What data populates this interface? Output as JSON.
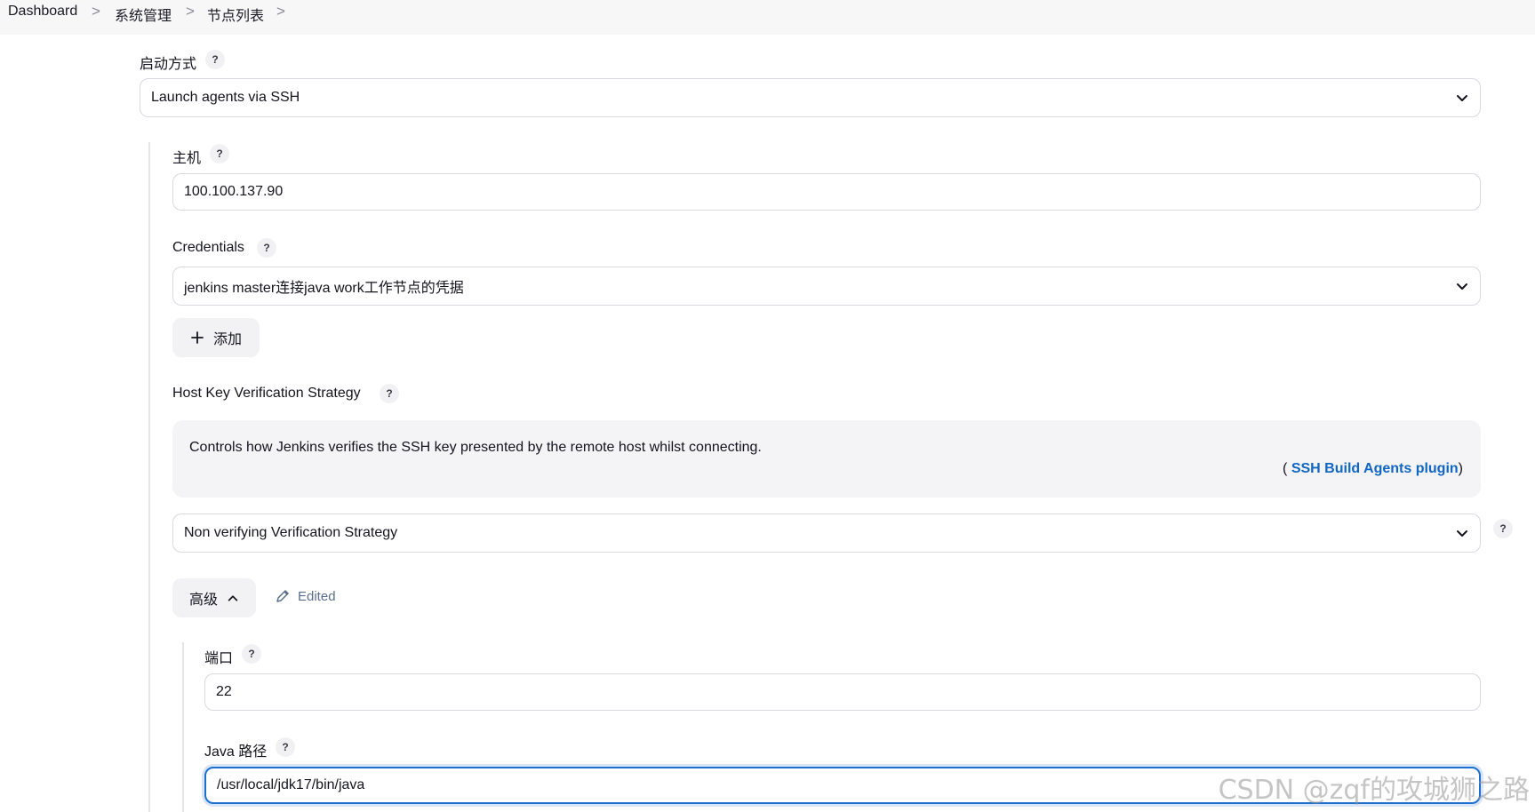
{
  "breadcrumb": {
    "items": [
      "Dashboard",
      "系统管理",
      "节点列表"
    ],
    "separator": ">"
  },
  "launch_method": {
    "label": "启动方式",
    "help": "?",
    "value": "Launch agents via SSH"
  },
  "host": {
    "label": "主机",
    "help": "?",
    "value": "100.100.137.90"
  },
  "credentials": {
    "label": "Credentials",
    "help": "?",
    "value": "jenkins master连接java work工作节点的凭据",
    "add_button": "添加"
  },
  "host_key": {
    "label": "Host Key Verification Strategy",
    "help": "?",
    "description": "Controls how Jenkins verifies the SSH key presented by the remote host whilst connecting.",
    "plugin_open": "(",
    "plugin_link": "SSH Build Agents plugin",
    "plugin_close": ")",
    "value": "Non verifying Verification Strategy",
    "side_help": "?"
  },
  "advanced": {
    "button": "高级",
    "edited": "Edited"
  },
  "port": {
    "label": "端口",
    "help": "?",
    "value": "22"
  },
  "java_path": {
    "label": "Java 路径",
    "help": "?",
    "value": "/usr/local/jdk17/bin/java"
  },
  "watermark": "CSDN @zqf的攻城狮之路",
  "colors": {
    "link": "#1066c4",
    "focus": "#1f6fd1",
    "muted": "#5a6f8c"
  }
}
